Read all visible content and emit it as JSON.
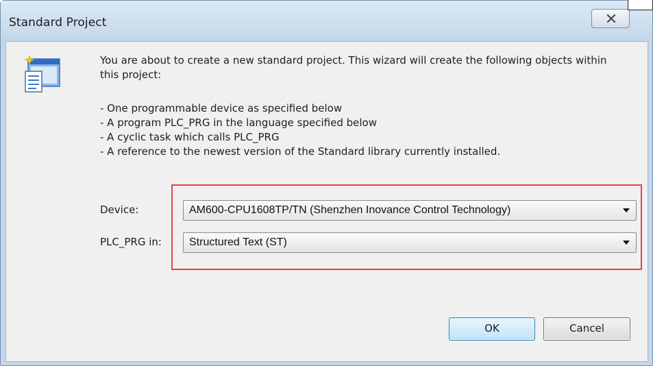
{
  "window": {
    "title": "Standard Project",
    "close_icon": "close-x-icon"
  },
  "content": {
    "wizard_icon": "wizard-document-icon",
    "description": "You are about to create a new standard project. This wizard will create the following objects within this project:",
    "bullets": [
      "- One programmable device as specified below",
      "- A program PLC_PRG in the language specified below",
      "- A cyclic task which calls PLC_PRG",
      "- A reference to the newest version of the Standard library currently installed."
    ]
  },
  "form": {
    "device_label": "Device:",
    "device_value": "AM600-CPU1608TP/TN (Shenzhen Inovance Control Technology)",
    "plc_prg_label": "PLC_PRG in:",
    "plc_prg_value": "Structured Text (ST)",
    "highlight_color": "#e2444a"
  },
  "buttons": {
    "ok": "OK",
    "cancel": "Cancel"
  }
}
